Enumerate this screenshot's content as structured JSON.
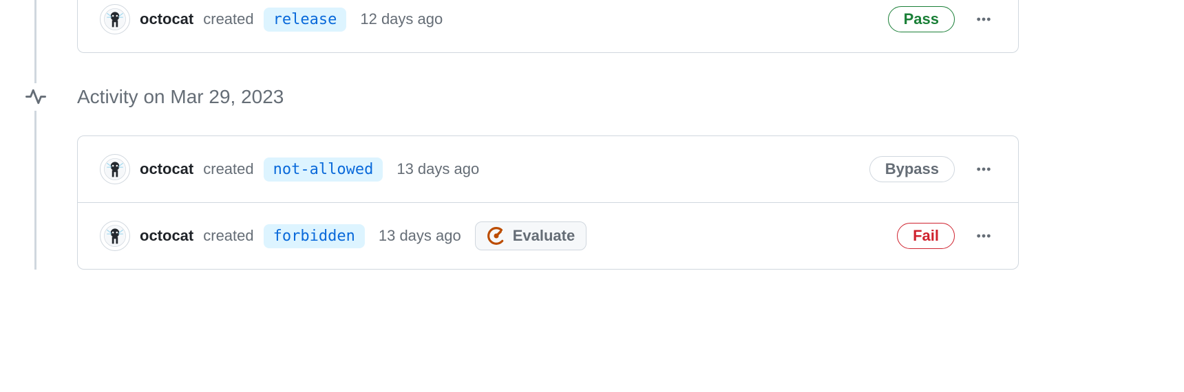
{
  "groups": [
    {
      "items": [
        {
          "username": "octocat",
          "action": "created",
          "branch": "release",
          "time": "12 days ago",
          "status": {
            "label": "Pass",
            "style": "pass"
          },
          "evaluate": null
        }
      ]
    }
  ],
  "date_header": "Activity on Mar 29, 2023",
  "groups2": [
    {
      "items": [
        {
          "username": "octocat",
          "action": "created",
          "branch": "not-allowed",
          "time": "13 days ago",
          "status": {
            "label": "Bypass",
            "style": "bypass"
          },
          "evaluate": null
        },
        {
          "username": "octocat",
          "action": "created",
          "branch": "forbidden",
          "time": "13 days ago",
          "status": {
            "label": "Fail",
            "style": "fail"
          },
          "evaluate": {
            "label": "Evaluate"
          }
        }
      ]
    }
  ]
}
